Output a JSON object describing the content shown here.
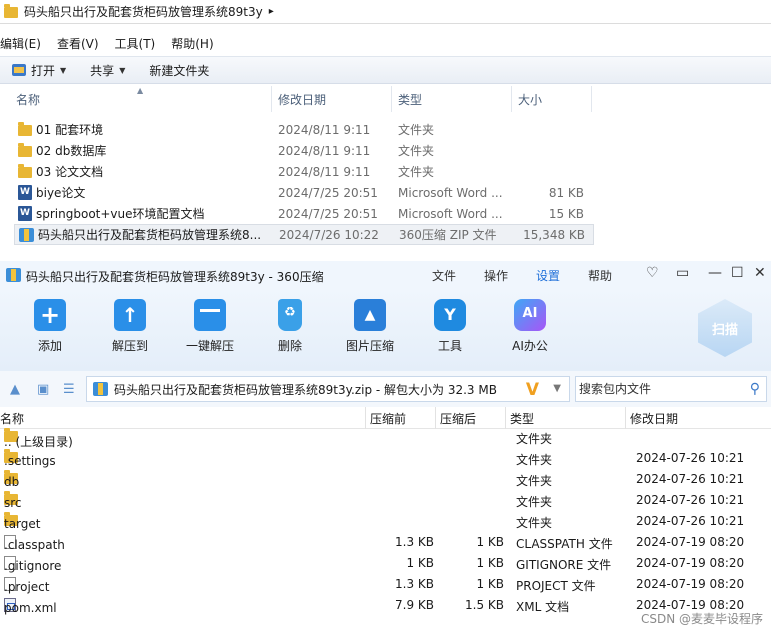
{
  "explorer": {
    "breadcrumb": "码头船只出行及配套货柜码放管理系统89t3y",
    "breadcrumb_arrow": "▸",
    "menu": [
      "编辑(E)",
      "查看(V)",
      "工具(T)",
      "帮助(H)"
    ],
    "toolbar": {
      "open": "打开",
      "share": "共享",
      "new_folder": "新建文件夹"
    },
    "columns": {
      "name": "名称",
      "modified": "修改日期",
      "type": "类型",
      "size": "大小"
    },
    "rows": [
      {
        "name": "01 配套环境",
        "modified": "2024/8/11 9:11",
        "type": "文件夹",
        "size": "",
        "icon": "folder-icon"
      },
      {
        "name": "02 db数据库",
        "modified": "2024/8/11 9:11",
        "type": "文件夹",
        "size": "",
        "icon": "folder-icon"
      },
      {
        "name": "03 论文文档",
        "modified": "2024/8/11 9:11",
        "type": "文件夹",
        "size": "",
        "icon": "folder-icon"
      },
      {
        "name": "biye论文",
        "modified": "2024/7/25 20:51",
        "type": "Microsoft Word ...",
        "size": "81 KB",
        "icon": "word-icon"
      },
      {
        "name": "springboot+vue环境配置文档",
        "modified": "2024/7/25 20:51",
        "type": "Microsoft Word ...",
        "size": "15 KB",
        "icon": "word-icon"
      },
      {
        "name": "码头船只出行及配套货柜码放管理系统8...",
        "modified": "2024/7/26 10:22",
        "type": "360压缩 ZIP 文件",
        "size": "15,348 KB",
        "icon": "zip-icon"
      }
    ]
  },
  "zip": {
    "title": "码头船只出行及配套货柜码放管理系统89t3y - 360压缩",
    "menu": {
      "file": "文件",
      "action": "操作",
      "settings": "设置",
      "help": "帮助"
    },
    "accent": "#1e6fd9",
    "tools": {
      "add": "添加",
      "extract": "解压到",
      "onekey": "一键解压",
      "delete": "删除",
      "img": "图片压缩",
      "tools": "工具",
      "ai": "AI办公"
    },
    "scan": "扫描",
    "path": "码头船只出行及配套货柜码放管理系统89t3y.zip - 解包大小为 32.3 MB",
    "search_placeholder": "搜索包内文件",
    "columns": {
      "name": "名称",
      "packed_before": "压缩前",
      "packed_after": "压缩后",
      "type": "类型",
      "modified": "修改日期"
    },
    "rows": [
      {
        "name": ".. (上级目录)",
        "before": "",
        "after": "",
        "type": "文件夹",
        "date": "",
        "icon": "folder-icon"
      },
      {
        "name": ".settings",
        "before": "",
        "after": "",
        "type": "文件夹",
        "date": "2024-07-26 10:21",
        "icon": "folder-icon"
      },
      {
        "name": "db",
        "before": "",
        "after": "",
        "type": "文件夹",
        "date": "2024-07-26 10:21",
        "icon": "folder-icon"
      },
      {
        "name": "src",
        "before": "",
        "after": "",
        "type": "文件夹",
        "date": "2024-07-26 10:21",
        "icon": "folder-icon"
      },
      {
        "name": "target",
        "before": "",
        "after": "",
        "type": "文件夹",
        "date": "2024-07-26 10:21",
        "icon": "folder-icon"
      },
      {
        "name": ".classpath",
        "before": "1.3 KB",
        "after": "1 KB",
        "type": "CLASSPATH 文件",
        "date": "2024-07-19 08:20",
        "icon": "file-icon"
      },
      {
        "name": ".gitignore",
        "before": "1 KB",
        "after": "1 KB",
        "type": "GITIGNORE 文件",
        "date": "2024-07-19 08:20",
        "icon": "file-icon"
      },
      {
        "name": ".project",
        "before": "1.3 KB",
        "after": "1 KB",
        "type": "PROJECT 文件",
        "date": "2024-07-19 08:20",
        "icon": "file-icon"
      },
      {
        "name": "pom.xml",
        "before": "7.9 KB",
        "after": "1.5 KB",
        "type": "XML 文档",
        "date": "2024-07-19 08:20",
        "icon": "xml-icon"
      }
    ]
  },
  "watermark": "CSDN @麦麦毕设程序"
}
